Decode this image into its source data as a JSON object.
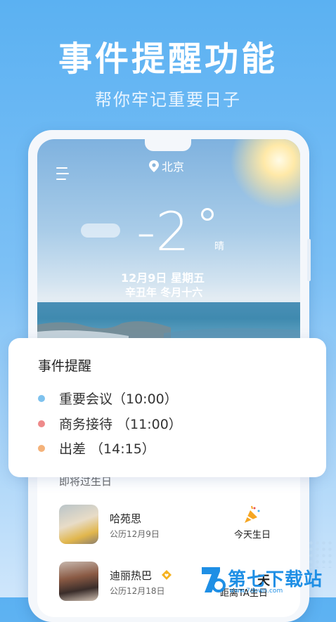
{
  "promo": {
    "title": "事件提醒功能",
    "subtitle": "帮你牢记重要日子"
  },
  "weather": {
    "location": "北京",
    "temperature": "-2",
    "condition": "晴",
    "date": "12月9日   星期五",
    "lunar": "辛丑年 冬月十六"
  },
  "event_card": {
    "title": "事件提醒",
    "events": [
      {
        "label": "重要会议（10:00）",
        "color": "#7ec2ee"
      },
      {
        "label": "商务接待 （11:00）",
        "color": "#ee8a8a"
      },
      {
        "label": "出差 （14:15）",
        "color": "#f4b27a"
      }
    ]
  },
  "birthdays": {
    "header": "即将过生日",
    "items": [
      {
        "name": "哈苑思",
        "date": "公历12月9日",
        "status": "今天生日"
      },
      {
        "name": "迪丽热巴",
        "date": "公历12月18日",
        "status_day": "天",
        "status_prefix": "距离TA生日"
      }
    ]
  },
  "watermark": {
    "text": "第七下载站",
    "url": "www.7down.com"
  },
  "colors": {
    "background_top": "#5bb1f2",
    "accent": "#1f8fe5"
  }
}
